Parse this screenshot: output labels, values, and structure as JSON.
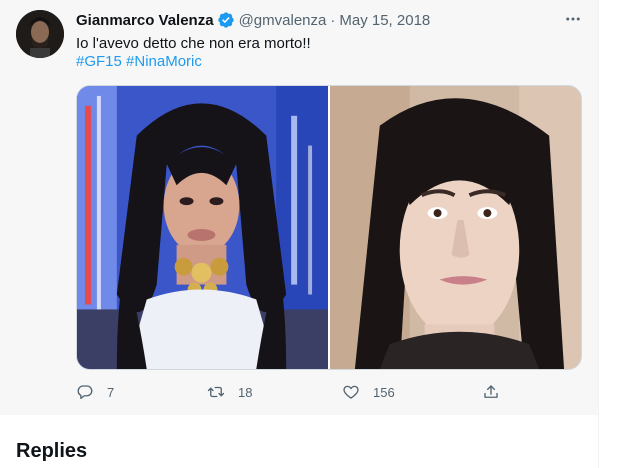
{
  "tweet": {
    "display_name": "Gianmarco Valenza",
    "verified": true,
    "handle": "@gmvalenza",
    "separator": "·",
    "date": "May 15, 2018",
    "text": "Io l'avevo detto che non era morto!!",
    "hashtags": [
      "#GF15",
      "#NinaMoric"
    ]
  },
  "actions": {
    "reply_count": "7",
    "retweet_count": "18",
    "like_count": "156"
  },
  "section": {
    "replies_title": "Replies"
  },
  "colors": {
    "accent": "#1d9bf0",
    "text": "#0f1419",
    "secondary_text": "#536471",
    "tweet_bg": "#f7f7f7"
  },
  "icons": {
    "more": "more-horizontal-icon",
    "verified": "verified-badge-icon",
    "reply": "reply-icon",
    "retweet": "retweet-icon",
    "like": "heart-icon",
    "share": "share-icon"
  }
}
